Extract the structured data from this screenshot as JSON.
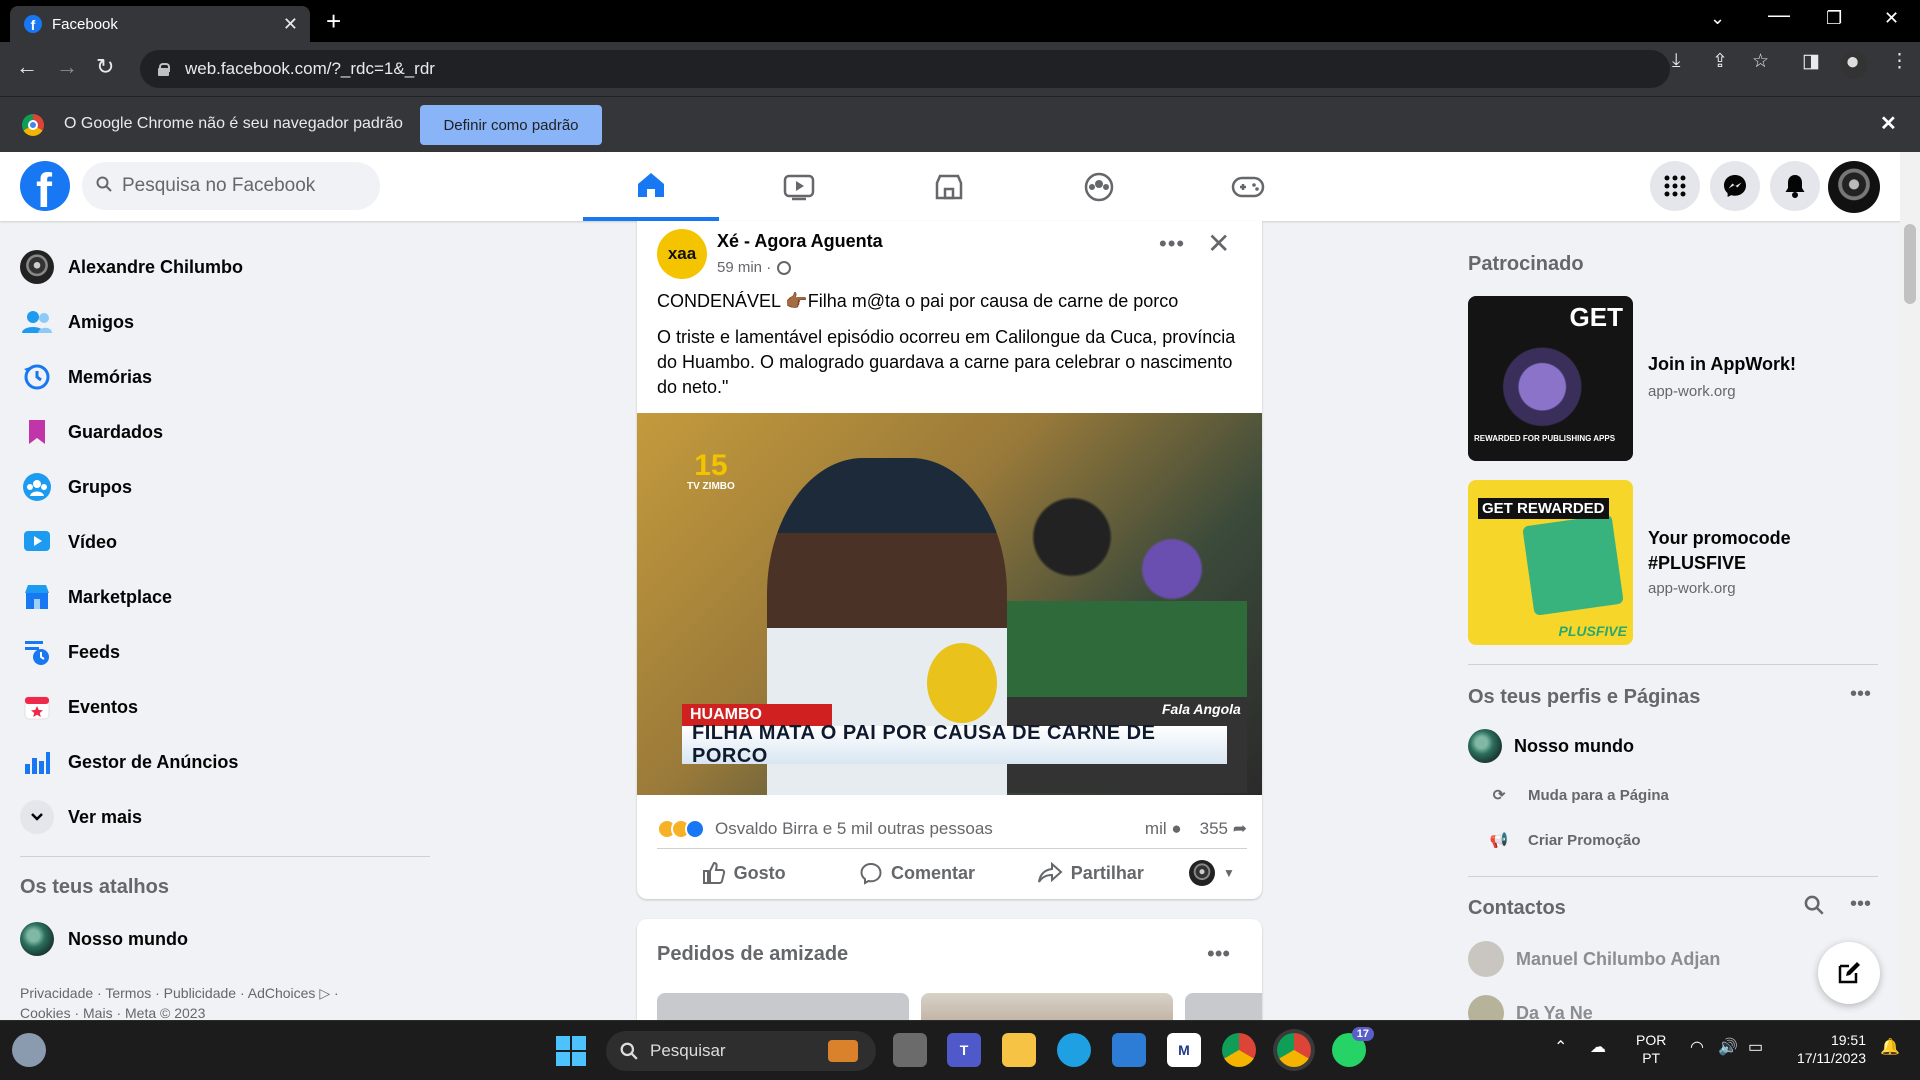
{
  "browser": {
    "tab_title": "Facebook",
    "url": "web.facebook.com/?_rdc=1&_rdr",
    "infobar_text": "O Google Chrome não é seu navegador padrão",
    "infobar_button": "Definir como padrão"
  },
  "header": {
    "search_placeholder": "Pesquisa no Facebook",
    "nav_tabs": [
      "home",
      "video",
      "marketplace",
      "groups",
      "gaming"
    ],
    "active_tab": "home"
  },
  "sidebar": {
    "items": [
      {
        "label": "Alexandre Chilumbo",
        "icon": "user-avatar"
      },
      {
        "label": "Amigos",
        "icon": "friends-icon"
      },
      {
        "label": "Memórias",
        "icon": "memories-icon"
      },
      {
        "label": "Guardados",
        "icon": "saved-icon"
      },
      {
        "label": "Grupos",
        "icon": "groups-icon"
      },
      {
        "label": "Vídeo",
        "icon": "video-icon"
      },
      {
        "label": "Marketplace",
        "icon": "marketplace-icon"
      },
      {
        "label": "Feeds",
        "icon": "feeds-icon"
      },
      {
        "label": "Eventos",
        "icon": "events-icon"
      },
      {
        "label": "Gestor de Anúncios",
        "icon": "ads-manager-icon"
      },
      {
        "label": "Ver mais",
        "icon": "chevron-down-icon"
      }
    ],
    "shortcuts_title": "Os teus atalhos",
    "shortcuts": [
      {
        "label": "Nosso mundo"
      }
    ],
    "footer_line1": "Privacidade · Termos · Publicidade · AdChoices ▷ ·",
    "footer_line2": "Cookies · Mais · Meta © 2023"
  },
  "post": {
    "page_avatar_text": "xaa",
    "page_name": "Xé - Agora Aguenta",
    "time": "59 min ·",
    "headline": "CONDENÁVEL 👉🏾Filha m@ta o pai por causa de carne de porco",
    "body": "O triste e lamentável episódio ocorreu em Calilongue da Cuca, província do Huambo. O malogrado guardava a carne para celebrar o nascimento do neto.\"",
    "media": {
      "channel": "TV ZIMBO",
      "channel_number": "15",
      "chyron_tag": "HUAMBO",
      "chyron_text": "FILHA MATA O PAI POR CAUSA DE CARNE DE PORCO",
      "watermark": "Fala Angola",
      "mic_label": "TV ZIMBO"
    },
    "reactions_text": "Osvaldo Birra e 5 mil outras pessoas",
    "comments_count": "mil",
    "shares_count": "355",
    "actions": {
      "like": "Gosto",
      "comment": "Comentar",
      "share": "Partilhar"
    }
  },
  "friend_requests": {
    "title": "Pedidos de amizade"
  },
  "right": {
    "sponsored_title": "Patrocinado",
    "ads": [
      {
        "title": "Join in AppWork!",
        "domain": "app-work.org",
        "image_text": "GET",
        "image_caption": "REWARDED FOR PUBLISHING APPS"
      },
      {
        "title_line1": "Your promocode",
        "title_line2": "#PLUSFIVE",
        "domain": "app-work.org",
        "image_text": "GET REWARDED",
        "image_caption": "PLUSFIVE"
      }
    ],
    "profiles_title": "Os teus perfis e Páginas",
    "profile_name": "Nosso mundo",
    "switch_page": "Muda para a Página",
    "create_promo": "Criar Promoção",
    "contacts_title": "Contactos",
    "contacts": [
      "Manuel Chilumbo Adjan",
      "Da Ya Ne"
    ]
  },
  "taskbar": {
    "search_label": "Pesquisar",
    "whatsapp_badge": "17",
    "lang_line1": "POR",
    "lang_line2": "PT",
    "time": "19:51",
    "date": "17/11/2023"
  },
  "colors": {
    "facebook_blue": "#1877f2",
    "chrome_dark": "#35363a",
    "infobar_button": "#8ab4f8",
    "feed_bg": "#f0f2f5"
  }
}
